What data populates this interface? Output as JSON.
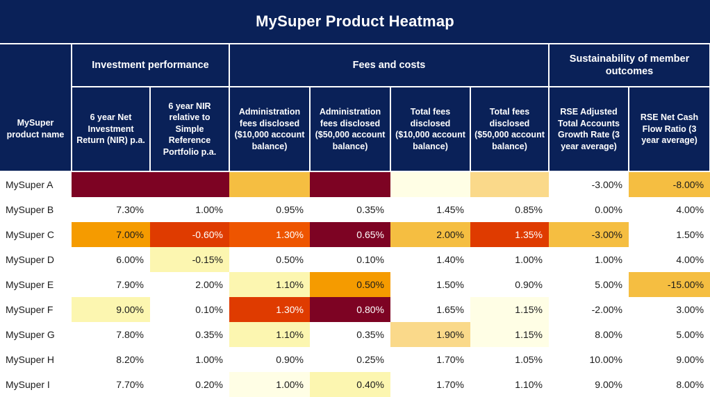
{
  "title": "MySuper Product Heatmap",
  "theme": {
    "header_navy": "#0A2158",
    "header_text": "#FFFFFF",
    "maroon": "#7D0323",
    "red_orange": "#DF3B00",
    "orange": "#F59B00",
    "amber": "#F5BE41",
    "light_amber": "#FAD98A",
    "pale_yellow": "#FCF6B0",
    "cream": "#FFFEE5",
    "white": "#FFFFFF"
  },
  "groups": [
    {
      "id": "rowname",
      "label": ""
    },
    {
      "id": "investment-performance",
      "label": "Investment performance",
      "span": 2
    },
    {
      "id": "fees-and-costs",
      "label": "Fees and costs",
      "span": 4
    },
    {
      "id": "sustainability-of-member-outcomes",
      "label": "Sustainability of member outcomes",
      "span": 2
    }
  ],
  "columns": [
    {
      "id": "product-name",
      "label": "MySuper\nproduct name"
    },
    {
      "id": "nir-6yr",
      "label": "6 year Net Investment Return (NIR) p.a."
    },
    {
      "id": "nir-vs-srp",
      "label": "6 year NIR relative to Simple Reference Portfolio p.a."
    },
    {
      "id": "admin-fees-10k",
      "label": "Administration fees disclosed ($10,000 account balance)"
    },
    {
      "id": "admin-fees-50k",
      "label": "Administration fees disclosed ($50,000 account balance)"
    },
    {
      "id": "total-fees-10k",
      "label": "Total fees disclosed ($10,000 account balance)"
    },
    {
      "id": "total-fees-50k",
      "label": "Total fees disclosed ($50,000 account balance)"
    },
    {
      "id": "rse-accounts-growth",
      "label": "RSE Adjusted Total Accounts Growth Rate (3 year average)"
    },
    {
      "id": "rse-net-cash-flow",
      "label": "RSE Net Cash Flow Ratio (3 year average)"
    }
  ],
  "chart_data": {
    "type": "heatmap",
    "title": "MySuper Product Heatmap",
    "xlabel": "",
    "ylabel": "",
    "categories": [
      "6 year Net Investment Return (NIR) p.a.",
      "6 year NIR relative to Simple Reference Portfolio p.a.",
      "Administration fees disclosed ($10,000 account balance)",
      "Administration fees disclosed ($50,000 account balance)",
      "Total fees disclosed ($10,000 account balance)",
      "Total fees disclosed ($50,000 account balance)",
      "RSE Adjusted Total Accounts Growth Rate (3 year average)",
      "RSE Net Cash Flow Ratio (3 year average)"
    ],
    "rows": [
      "MySuper A",
      "MySuper B",
      "MySuper C",
      "MySuper D",
      "MySuper E",
      "MySuper F",
      "MySuper G",
      "MySuper H",
      "MySuper I"
    ],
    "color_scale": {
      "maroon": "#7D0323",
      "red_orange": "#DF3B00",
      "orange": "#F59B00",
      "amber": "#F5BE41",
      "light_amber": "#FAD98A",
      "pale_yellow": "#FCF6B0",
      "cream": "#FFFEE5",
      "none": "#FFFFFF"
    },
    "values": [
      [
        "",
        "",
        "",
        "",
        "",
        "",
        "-3.00%",
        "-8.00%"
      ],
      [
        "7.30%",
        "1.00%",
        "0.95%",
        "0.35%",
        "1.45%",
        "0.85%",
        "0.00%",
        "4.00%"
      ],
      [
        "7.00%",
        "-0.60%",
        "1.30%",
        "0.65%",
        "2.00%",
        "1.35%",
        "-3.00%",
        "1.50%"
      ],
      [
        "6.00%",
        "-0.15%",
        "0.50%",
        "0.10%",
        "1.40%",
        "1.00%",
        "1.00%",
        "4.00%"
      ],
      [
        "7.90%",
        "2.00%",
        "1.10%",
        "0.50%",
        "1.50%",
        "0.90%",
        "5.00%",
        "-15.00%"
      ],
      [
        "9.00%",
        "0.10%",
        "1.30%",
        "0.80%",
        "1.65%",
        "1.15%",
        "-2.00%",
        "3.00%"
      ],
      [
        "7.80%",
        "0.35%",
        "1.10%",
        "0.35%",
        "1.90%",
        "1.15%",
        "8.00%",
        "5.00%"
      ],
      [
        "8.20%",
        "1.00%",
        "0.90%",
        "0.25%",
        "1.70%",
        "1.05%",
        "10.00%",
        "9.00%"
      ],
      [
        "7.70%",
        "0.20%",
        "1.00%",
        "0.40%",
        "1.70%",
        "1.10%",
        "9.00%",
        "8.00%"
      ]
    ],
    "cell_colors": [
      [
        "#7D0323",
        "#7D0323",
        "#F5BE41",
        "#7D0323",
        "#FFFEE5",
        "#FAD98A",
        "#FFFFFF",
        "#F5BE41"
      ],
      [
        "#FFFFFF",
        "#FFFFFF",
        "#FFFFFF",
        "#FFFFFF",
        "#FFFFFF",
        "#FFFFFF",
        "#FFFFFF",
        "#FFFFFF"
      ],
      [
        "#F59B00",
        "#DF3B00",
        "#EE5500",
        "#7D0323",
        "#F5BE41",
        "#DF3B00",
        "#F5BE41",
        "#FFFFFF"
      ],
      [
        "#FFFFFF",
        "#FCF6B0",
        "#FFFFFF",
        "#FFFFFF",
        "#FFFFFF",
        "#FFFFFF",
        "#FFFFFF",
        "#FFFFFF"
      ],
      [
        "#FFFFFF",
        "#FFFFFF",
        "#FCF6B0",
        "#F59B00",
        "#FFFFFF",
        "#FFFFFF",
        "#FFFFFF",
        "#F5BE41"
      ],
      [
        "#FCF6B0",
        "#FFFFFF",
        "#DF3B00",
        "#7D0323",
        "#FFFFFF",
        "#FFFEE5",
        "#FFFFFF",
        "#FFFFFF"
      ],
      [
        "#FFFFFF",
        "#FFFFFF",
        "#FCF6B0",
        "#FFFFFF",
        "#FAD98A",
        "#FFFEE5",
        "#FFFFFF",
        "#FFFFFF"
      ],
      [
        "#FFFFFF",
        "#FFFFFF",
        "#FFFFFF",
        "#FFFFFF",
        "#FFFFFF",
        "#FFFFFF",
        "#FFFFFF",
        "#FFFFFF"
      ],
      [
        "#FFFFFF",
        "#FFFFFF",
        "#FFFEE5",
        "#FCF6B0",
        "#FFFFFF",
        "#FFFFFF",
        "#FFFFFF",
        "#FFFFFF"
      ]
    ],
    "text_colors": [
      [
        "#1a1a1a",
        "#1a1a1a",
        "#1a1a1a",
        "#1a1a1a",
        "#1a1a1a",
        "#1a1a1a",
        "#1a1a1a",
        "#1a1a1a"
      ],
      [
        "#1a1a1a",
        "#1a1a1a",
        "#1a1a1a",
        "#1a1a1a",
        "#1a1a1a",
        "#1a1a1a",
        "#1a1a1a",
        "#1a1a1a"
      ],
      [
        "#1a1a1a",
        "#ffffff",
        "#ffffff",
        "#ffffff",
        "#1a1a1a",
        "#ffffff",
        "#1a1a1a",
        "#1a1a1a"
      ],
      [
        "#1a1a1a",
        "#1a1a1a",
        "#1a1a1a",
        "#1a1a1a",
        "#1a1a1a",
        "#1a1a1a",
        "#1a1a1a",
        "#1a1a1a"
      ],
      [
        "#1a1a1a",
        "#1a1a1a",
        "#1a1a1a",
        "#1a1a1a",
        "#1a1a1a",
        "#1a1a1a",
        "#1a1a1a",
        "#1a1a1a"
      ],
      [
        "#1a1a1a",
        "#1a1a1a",
        "#ffffff",
        "#ffffff",
        "#1a1a1a",
        "#1a1a1a",
        "#1a1a1a",
        "#1a1a1a"
      ],
      [
        "#1a1a1a",
        "#1a1a1a",
        "#1a1a1a",
        "#1a1a1a",
        "#1a1a1a",
        "#1a1a1a",
        "#1a1a1a",
        "#1a1a1a"
      ],
      [
        "#1a1a1a",
        "#1a1a1a",
        "#1a1a1a",
        "#1a1a1a",
        "#1a1a1a",
        "#1a1a1a",
        "#1a1a1a",
        "#1a1a1a"
      ],
      [
        "#1a1a1a",
        "#1a1a1a",
        "#1a1a1a",
        "#1a1a1a",
        "#1a1a1a",
        "#1a1a1a",
        "#1a1a1a",
        "#1a1a1a"
      ]
    ]
  }
}
